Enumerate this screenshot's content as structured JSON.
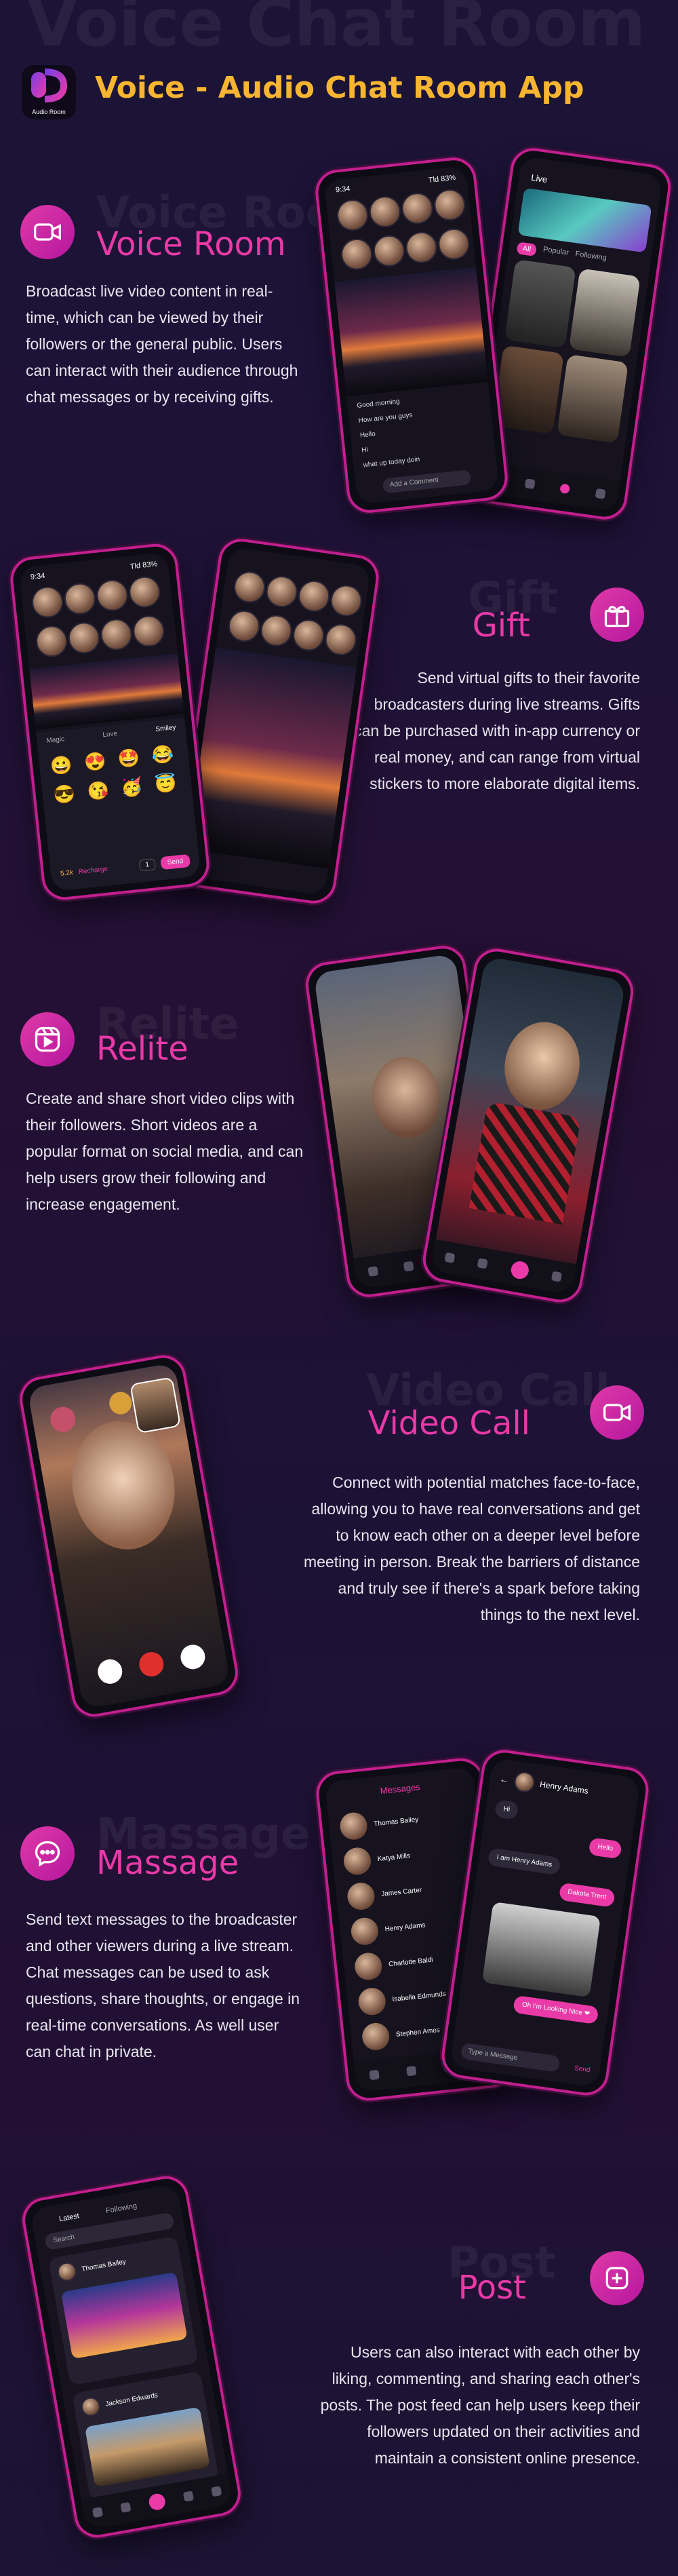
{
  "header": {
    "ghost_text": "Voice Chat Room",
    "title": "Voice - Audio Chat Room App",
    "logo_text": "Audio Room",
    "logo_icon": "mic-logo-icon"
  },
  "colors": {
    "accent_pink": "#e93aa7",
    "title_gold": "#f7b531",
    "background": "#1e1238"
  },
  "sections": [
    {
      "id": "voice-room",
      "ghost": "Voice Room",
      "title": "Voice Room",
      "icon": "video-camera-icon",
      "description": "Broadcast live video content in real-time, which can be viewed by their followers or the general public. Users can interact with their audience through chat messages or by receiving gifts."
    },
    {
      "id": "gift",
      "ghost": "Gift",
      "title": "Gift",
      "icon": "gift-icon",
      "description": "Send virtual gifts to their favorite broadcasters during live streams. Gifts can be purchased with in-app currency or real money, and can range from virtual stickers to more elaborate digital items."
    },
    {
      "id": "relite",
      "ghost": "Relite",
      "title": "Relite",
      "icon": "reels-icon",
      "description": "Create and share short video clips with their followers. Short videos are a popular format on social media, and can help users grow their following and increase engagement."
    },
    {
      "id": "video-call",
      "ghost": "Video Call",
      "title": "Video Call",
      "icon": "video-call-icon",
      "description": "Connect with potential matches face-to-face, allowing you to have real conversations and get to know each other on a deeper level before meeting in person. Break the barriers of distance and truly see if there's a spark before taking things to the next level."
    },
    {
      "id": "massage",
      "ghost": "Massage",
      "title": "Massage",
      "icon": "chat-bubble-icon",
      "description": "Send text messages to the broadcaster and other viewers during a live stream. Chat messages can be used to ask questions, share thoughts, or engage in real-time conversations. As well user can chat in private."
    },
    {
      "id": "post",
      "ghost": "Post",
      "title": "Post",
      "icon": "add-post-icon",
      "description": "Users can also interact with each other by liking, commenting, and sharing each other's posts. The post feed can help users keep their followers updated on their activities and maintain a consistent online presence."
    }
  ],
  "mockups": {
    "voice_room": {
      "time": "9:34",
      "battery": "Tld 83%",
      "live_tab": "Live",
      "tabs": [
        "All",
        "Popular",
        "Following"
      ],
      "chat_lines": [
        "Good morning",
        "How are you guys",
        "Hello",
        "Hi",
        "what up today doin"
      ],
      "comment_placeholder": "Add a Comment"
    },
    "gift": {
      "time": "9:34",
      "battery": "Tld 83%",
      "tabs": [
        "Magic",
        "Love",
        "Smiley"
      ],
      "coins": "5.2k",
      "recharge": "Recharge",
      "qty": "1",
      "send": "Send"
    },
    "massage": {
      "header": "Messages",
      "names": [
        "Thomas Bailey",
        "Katya Mills",
        "James Carter",
        "Henry Adams",
        "Charlotte Baldi",
        "Isabella Edmunds",
        "Stephen Ames"
      ],
      "chat_name": "Henry Adams",
      "bubbles_in": [
        "Hi",
        "I am Henry Adams"
      ],
      "bubbles_out": [
        "Hello",
        "Dakota Trent",
        "Oh I'm Looking Nice ❤"
      ],
      "type_placeholder": "Type a Message",
      "send": "Send"
    },
    "post": {
      "tabs": [
        "Latest",
        "Following"
      ],
      "search": "Search",
      "authors": [
        "Thomas Bailey",
        "Jackson Edwards"
      ]
    }
  }
}
